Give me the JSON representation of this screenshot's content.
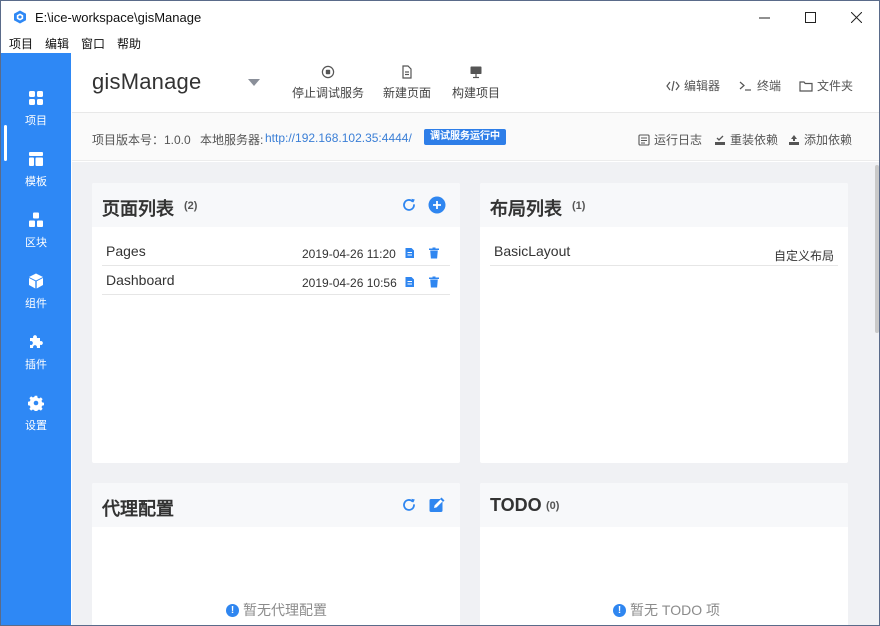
{
  "window": {
    "title": "E:\\ice-workspace\\gisManage",
    "minimize": "—",
    "maximize": "☐",
    "close": "✕"
  },
  "menu": [
    "项目",
    "编辑",
    "窗口",
    "帮助"
  ],
  "sidebar": {
    "items": [
      {
        "label": "项目",
        "icon": "grid-icon",
        "active": true
      },
      {
        "label": "模板",
        "icon": "template-icon"
      },
      {
        "label": "区块",
        "icon": "blocks-icon"
      },
      {
        "label": "组件",
        "icon": "cube-icon"
      },
      {
        "label": "插件",
        "icon": "puzzle-icon"
      },
      {
        "label": "设置",
        "icon": "gear-icon"
      }
    ]
  },
  "header": {
    "project_name": "gisManage",
    "actions": [
      {
        "label": "停止调试服务",
        "icon": "stop-icon"
      },
      {
        "label": "新建页面",
        "icon": "new-page-icon"
      },
      {
        "label": "构建项目",
        "icon": "build-icon"
      }
    ],
    "quick_links": [
      {
        "label": "编辑器",
        "icon": "code-icon"
      },
      {
        "label": "终端",
        "icon": "terminal-icon"
      },
      {
        "label": "文件夹",
        "icon": "folder-icon"
      }
    ]
  },
  "info": {
    "version_label": "项目版本号：1.0.0",
    "server_label": "本地服务器:",
    "server_url": "http://192.168.102.35:4444/",
    "status": "调试服务运行中",
    "actions": [
      {
        "label": "运行日志",
        "icon": "log-icon"
      },
      {
        "label": "重装依赖",
        "icon": "reinstall-icon"
      },
      {
        "label": "添加依赖",
        "icon": "add-dependency-icon"
      }
    ]
  },
  "cards": {
    "pages": {
      "title": "页面列表",
      "count": "(2)",
      "rows": [
        {
          "name": "Pages",
          "date": "2019-04-26 11:20"
        },
        {
          "name": "Dashboard",
          "date": "2019-04-26 10:56"
        }
      ]
    },
    "layouts": {
      "title": "布局列表",
      "count": "(1)",
      "rows": [
        {
          "name": "BasicLayout",
          "tag": "自定义布局"
        }
      ]
    },
    "proxy": {
      "title": "代理配置",
      "empty": "暂无代理配置"
    },
    "todo": {
      "title": "TODO",
      "count": "(0)",
      "empty": "暂无 TODO 项"
    }
  },
  "colors": {
    "accent": "#2e88f5",
    "badge": "#2e7ee8",
    "link": "#3b7fd6"
  }
}
